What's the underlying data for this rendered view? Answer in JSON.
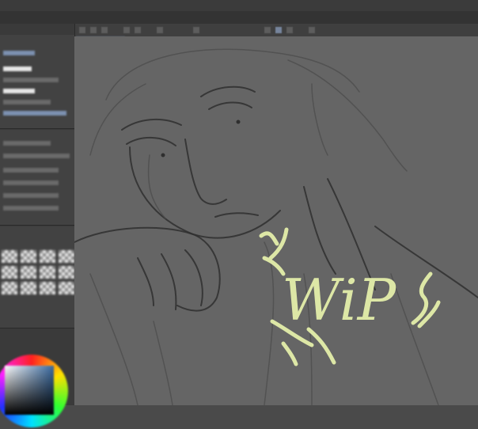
{
  "window": {
    "title": ""
  },
  "menu": {
    "items": [
      {
        "label": "",
        "name": "menu-file"
      },
      {
        "label": "",
        "name": "menu-edit"
      },
      {
        "label": "",
        "name": "menu-animation"
      },
      {
        "label": "",
        "name": "menu-layer"
      },
      {
        "label": "",
        "name": "menu-select"
      },
      {
        "label": "",
        "name": "menu-view"
      },
      {
        "label": "",
        "name": "menu-filter"
      },
      {
        "label": "",
        "name": "menu-window"
      },
      {
        "label": "",
        "name": "menu-help"
      }
    ]
  },
  "document": {
    "tab_label": ""
  },
  "canvas": {
    "overlay_text": "WiP",
    "overlay_color": "#dde7a6",
    "background_color": "#656565",
    "line_color": "#2f2f2f"
  },
  "palettes": {
    "color_wheel": {
      "current_color": "#3a6aa0"
    }
  }
}
